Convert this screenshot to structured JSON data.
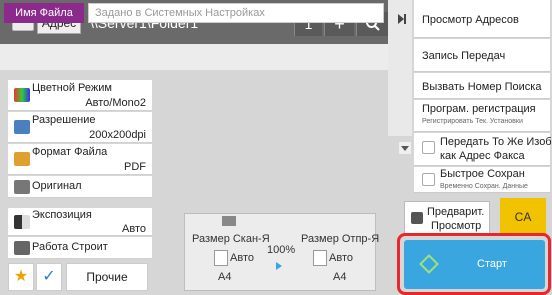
{
  "address_bar": {
    "label": "Адрес",
    "value": "\\\\Server1\\Folder1",
    "count": "1",
    "plus": "+",
    "search_glyph": "⚲"
  },
  "filename": {
    "label": "Имя Файла",
    "placeholder": "Задано в Системных Настройках"
  },
  "settings": [
    {
      "title": "Цветной Режим",
      "value": "Авто/Mono2",
      "icon": "color-mode-icon"
    },
    {
      "title": "Разрешение",
      "value": "200x200dpi",
      "icon": "resolution-icon"
    },
    {
      "title": "Формат Файла",
      "value": "PDF",
      "icon": "file-format-icon"
    },
    {
      "title": "Оригинал",
      "value": "",
      "icon": "original-icon"
    },
    {
      "title": "Экспозиция",
      "value": "Авто",
      "icon": "exposure-icon"
    },
    {
      "title": "Работа Строит",
      "value": "",
      "icon": "job-build-icon"
    }
  ],
  "bottom_left": {
    "star_glyph": "★",
    "check_glyph": "✓",
    "other_label": "Прочие"
  },
  "info": {
    "scan_size_label": "Размер Скан-Я",
    "send_size_label": "Размер Отпр-Я",
    "scale": "100%",
    "scan_auto": "Авто",
    "send_auto": "Авто",
    "scan_paper": "A4",
    "send_paper": "A4"
  },
  "side_panel": {
    "address_view": "Просмотр Адресов",
    "transmission_log": "Запись Передач",
    "call_search": "Вызвать Номер Поиска",
    "program_title": "Програм. регистрация",
    "program_sub": "Регистрировать Тек. Установки",
    "send_same_line1": "Передать То Же Изоб.",
    "send_same_line2": "как Адрес Факса",
    "quick_save_title": "Быстрое Сохран",
    "quick_save_sub": "Временно Сохран. Данные"
  },
  "actions": {
    "preview_line1": "Предварит.",
    "preview_line2": "Просмотр",
    "ca_label": "CA",
    "start_label": "Старт"
  },
  "colors": {
    "accent_purple": "#8c2a8c",
    "start_blue": "#3aa6e0",
    "ca_yellow": "#f0c200",
    "highlight_red": "#e8262c"
  }
}
